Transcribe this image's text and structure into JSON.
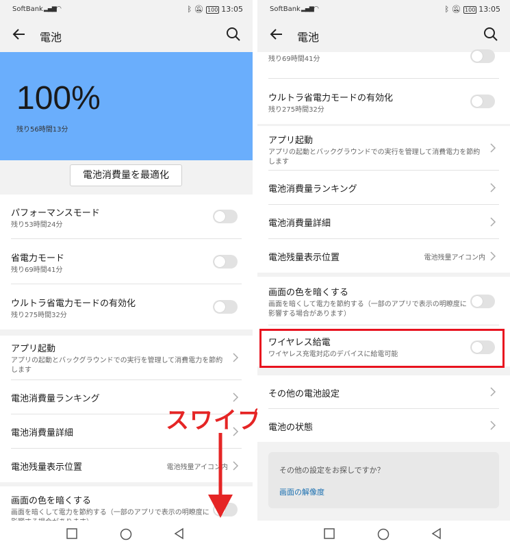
{
  "status": {
    "carrier": "SoftBank",
    "battery_badge": "100",
    "time": "13:05"
  },
  "appbar": {
    "title": "電池"
  },
  "hero": {
    "percent": "100%",
    "remaining": "残り56時間13分",
    "color": "#6aaefc"
  },
  "optimize_button": "電池消費量を最適化",
  "modes": [
    {
      "title": "パフォーマンスモード",
      "sub": "残り53時間24分"
    },
    {
      "title": "省電力モード",
      "sub": "残り69時間41分"
    },
    {
      "title": "ウルトラ省電力モードの有効化",
      "sub": "残り275時間32分"
    }
  ],
  "app_launch": {
    "title": "アプリ起動",
    "sub": "アプリの起動とバックグラウンドでの実行を管理して消費電力を節約します"
  },
  "ranking": "電池消費量ランキング",
  "detail": "電池消費量詳細",
  "position": {
    "title": "電池残量表示位置",
    "value": "電池残量アイコン内"
  },
  "darken": {
    "title": "画面の色を暗くする",
    "sub": "画面を暗くして電力を節約する（一部のアプリで表示の明瞭度に影響する場合があります）"
  },
  "wireless": {
    "title": "ワイヤレス給電",
    "sub": "ワイヤレス充電対応のデバイスに給電可能"
  },
  "other_settings": "その他の電池設定",
  "battery_state": "電池の状態",
  "suggest": {
    "question": "その他の設定をお探しですか？",
    "link": "画面の解像度"
  },
  "annotation": {
    "swipe": "スワイプ",
    "color": "#e52525"
  },
  "left_top_partial_sub": "残り69時間41分"
}
